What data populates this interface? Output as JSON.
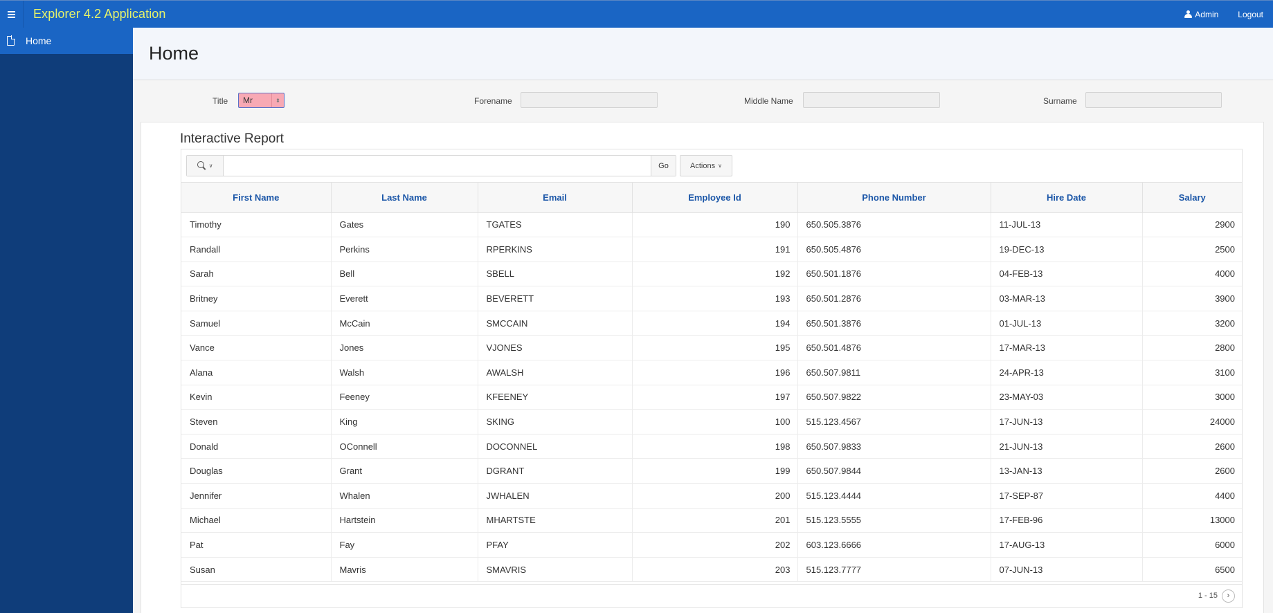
{
  "app": {
    "title": "Explorer 4.2 Application",
    "user_label": "Admin",
    "logout_label": "Logout",
    "brand_color": "#1a65c4",
    "title_color": "#e6f36b"
  },
  "sidebar": {
    "items": [
      {
        "label": "Home",
        "icon": "page-icon",
        "active": true
      }
    ]
  },
  "page": {
    "title": "Home"
  },
  "form": {
    "title_label": "Title",
    "title_value": "Mr",
    "forename_label": "Forename",
    "forename_value": "",
    "middle_name_label": "Middle Name",
    "middle_name_value": "",
    "surname_label": "Surname",
    "surname_value": ""
  },
  "report": {
    "title": "Interactive Report",
    "search_value": "",
    "go_label": "Go",
    "actions_label": "Actions",
    "columns": [
      "First Name",
      "Last Name",
      "Email",
      "Employee Id",
      "Phone Number",
      "Hire Date",
      "Salary"
    ],
    "rows": [
      [
        "Timothy",
        "Gates",
        "TGATES",
        "190",
        "650.505.3876",
        "11-JUL-13",
        "2900"
      ],
      [
        "Randall",
        "Perkins",
        "RPERKINS",
        "191",
        "650.505.4876",
        "19-DEC-13",
        "2500"
      ],
      [
        "Sarah",
        "Bell",
        "SBELL",
        "192",
        "650.501.1876",
        "04-FEB-13",
        "4000"
      ],
      [
        "Britney",
        "Everett",
        "BEVERETT",
        "193",
        "650.501.2876",
        "03-MAR-13",
        "3900"
      ],
      [
        "Samuel",
        "McCain",
        "SMCCAIN",
        "194",
        "650.501.3876",
        "01-JUL-13",
        "3200"
      ],
      [
        "Vance",
        "Jones",
        "VJONES",
        "195",
        "650.501.4876",
        "17-MAR-13",
        "2800"
      ],
      [
        "Alana",
        "Walsh",
        "AWALSH",
        "196",
        "650.507.9811",
        "24-APR-13",
        "3100"
      ],
      [
        "Kevin",
        "Feeney",
        "KFEENEY",
        "197",
        "650.507.9822",
        "23-MAY-03",
        "3000"
      ],
      [
        "Steven",
        "King",
        "SKING",
        "100",
        "515.123.4567",
        "17-JUN-13",
        "24000"
      ],
      [
        "Donald",
        "OConnell",
        "DOCONNEL",
        "198",
        "650.507.9833",
        "21-JUN-13",
        "2600"
      ],
      [
        "Douglas",
        "Grant",
        "DGRANT",
        "199",
        "650.507.9844",
        "13-JAN-13",
        "2600"
      ],
      [
        "Jennifer",
        "Whalen",
        "JWHALEN",
        "200",
        "515.123.4444",
        "17-SEP-87",
        "4400"
      ],
      [
        "Michael",
        "Hartstein",
        "MHARTSTE",
        "201",
        "515.123.5555",
        "17-FEB-96",
        "13000"
      ],
      [
        "Pat",
        "Fay",
        "PFAY",
        "202",
        "603.123.6666",
        "17-AUG-13",
        "6000"
      ],
      [
        "Susan",
        "Mavris",
        "SMAVRIS",
        "203",
        "515.123.7777",
        "07-JUN-13",
        "6500"
      ]
    ],
    "pagination": "1 - 15"
  }
}
